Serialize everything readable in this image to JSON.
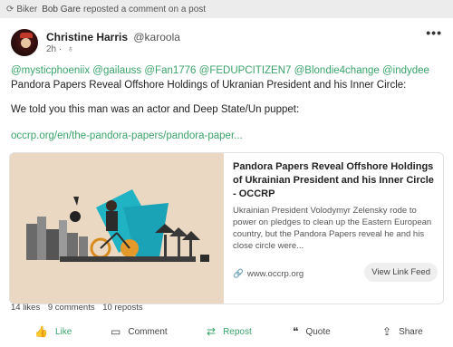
{
  "repost_bar": {
    "group": "Biker",
    "user": "Bob Gare",
    "text": "reposted a comment on a post"
  },
  "post": {
    "author_name": "Christine Harris",
    "author_handle": "@karoola",
    "time": "2h",
    "mentions": [
      "@mysticphoeniix",
      "@gailauss",
      "@Fan1776",
      "@FEDUPCITIZEN7",
      "@Blondie4change",
      "@indydee"
    ],
    "headline_text": "Pandora Papers Reveal Offshore Holdings of Ukranian President and his Inner Circle:",
    "paragraph": "We told you this man was an actor and Deep State/Un puppet:",
    "link": "occrp.org/en/the-pandora-papers/pandora-paper..."
  },
  "preview": {
    "title": "Pandora Papers Reveal Offshore Holdings of Ukrainian President and his Inner Circle - OCCRP",
    "description": "Ukrainian President Volodymyr Zelensky rode to power on pledges to clean up the Eastern European country, but the Pandora Papers reveal he and his close circle were...",
    "domain": "www.occrp.org",
    "button": "View Link Feed"
  },
  "stats": {
    "likes": "14 likes",
    "comments": "9 comments",
    "reposts": "10 reposts"
  },
  "actions": {
    "like": "Like",
    "comment": "Comment",
    "repost": "Repost",
    "quote": "Quote",
    "share": "Share"
  },
  "colors": {
    "accent": "#3aa36a",
    "bar_bg": "#ececec"
  }
}
